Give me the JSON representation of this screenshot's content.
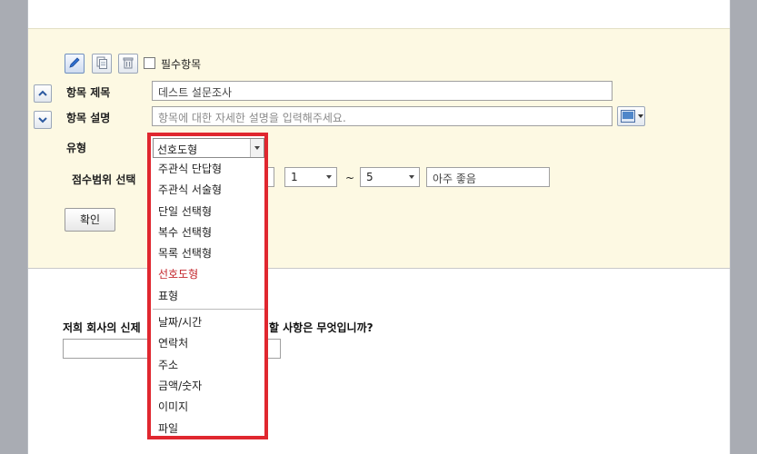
{
  "toolbar": {
    "required_label": "필수항목"
  },
  "form": {
    "title_label": "항목 제목",
    "title_value": "데스트 설문조사",
    "desc_label": "항목 설명",
    "desc_placeholder": "항목에 대한 자세한 설명을 입력해주세요.",
    "type_label": "유형",
    "type_value": "선호도형",
    "score_label": "점수범위 선택",
    "score_min": "1",
    "score_tilde": "~",
    "score_max": "5",
    "score_max_text": "아주 좋음",
    "confirm_label": "확인"
  },
  "dropdown": {
    "selected": "선호도형",
    "items_group1": [
      "주관식 단답형",
      "주관식 서술형",
      "단일 선택형",
      "복수 선택형",
      "목록 선택형",
      "선호도형",
      "표형"
    ],
    "items_group2": [
      "날짜/시간",
      "연락처",
      "주소",
      "금액/숫자",
      "이미지",
      "파일"
    ]
  },
  "preview": {
    "question_start": "저희 회사의 신제",
    "question_end": "해야 할 사항은 무엇입니까?"
  },
  "colors": {
    "highlight": "#e0272f",
    "editor_bg": "#fdf9e3"
  }
}
